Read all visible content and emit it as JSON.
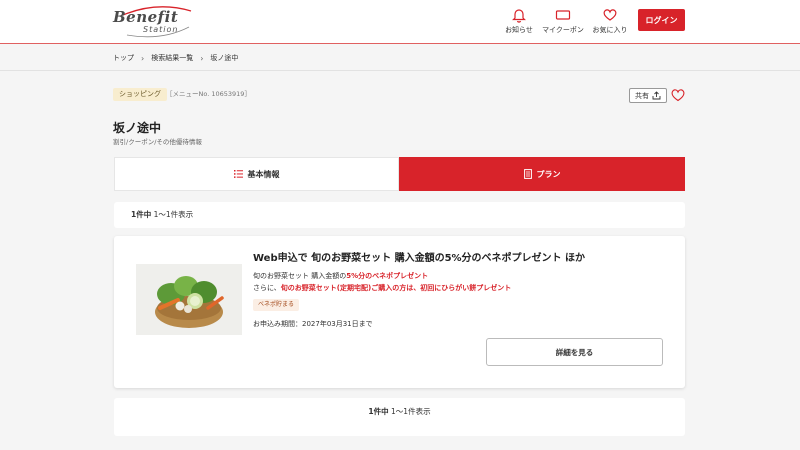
{
  "header": {
    "logo_benefit": "Benefit",
    "logo_station": "Station",
    "nav": [
      {
        "label": "お知らせ",
        "icon": "bell-icon"
      },
      {
        "label": "マイクーポン",
        "icon": "coupon-icon"
      },
      {
        "label": "お気に入り",
        "icon": "heart-icon"
      }
    ],
    "login_label": "ログイン"
  },
  "breadcrumb": [
    "トップ",
    "検索結果一覧",
    "坂ノ途中"
  ],
  "item": {
    "category": "ショッピング",
    "menu_no": "［メニューNo. 10653919］",
    "share_label": "共有",
    "title": "坂ノ途中",
    "subtitle": "割引/クーポン/その他優待情報"
  },
  "tabs": {
    "basic": "基本情報",
    "plan": "プラン"
  },
  "results": {
    "count": "1件中",
    "range": "1〜1件表示"
  },
  "plan": {
    "title": "Web申込で 旬のお野菜セット 購入金額の5%分のベネポプレゼント ほか",
    "desc1_prefix": "旬のお野菜セット 購入金額の",
    "desc1_highlight": "5%分のベネポプレゼント",
    "desc2_prefix": "さらに、",
    "desc2_highlight": "旬のお野菜セット(定期宅配)ご購入の方は、初回にひらがい餅プレゼント",
    "badge": "ベネポ貯まる",
    "period": "お申込み期間：2027年03月31日まで",
    "detail_label": "詳細を見る"
  },
  "colors": {
    "accent": "#d8232a",
    "tag_bg": "#f8edcf"
  }
}
